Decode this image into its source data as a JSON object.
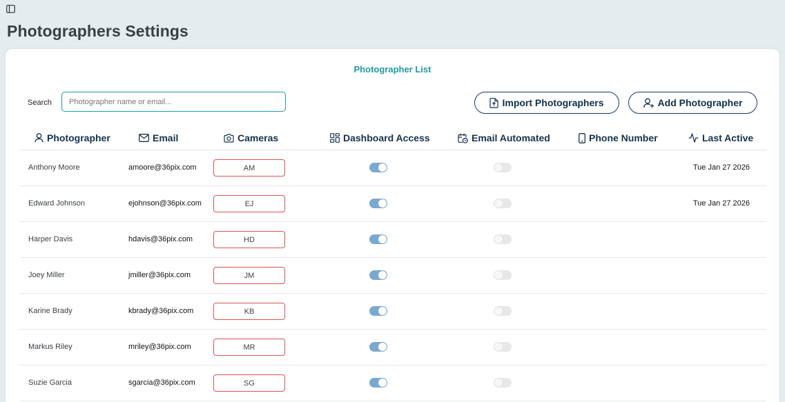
{
  "page": {
    "title": "Photographers Settings"
  },
  "card": {
    "title": "Photographer List"
  },
  "search": {
    "label": "Search",
    "placeholder": "Photographer name or email...",
    "value": ""
  },
  "buttons": {
    "import_label": "Import Photographers",
    "add_label": "Add Photographer"
  },
  "icons": {
    "sidebar_toggle": "sidebar-toggle-icon",
    "import": "file-upload-icon",
    "add": "user-plus-icon",
    "photographer": "user-icon",
    "email": "mail-icon",
    "cameras": "camera-icon",
    "dashboard": "dashboard-grid-icon",
    "email_automated": "calendar-clock-icon",
    "phone": "phone-icon",
    "last_active": "activity-icon"
  },
  "colors": {
    "accent": "#1f9aa0",
    "primary": "#0f3a5c",
    "camera_border": "#d9534f",
    "toggle_on": "#7aa9d0",
    "toggle_off": "#e8e8e8"
  },
  "columns": {
    "photographer": "Photographer",
    "email": "Email",
    "cameras": "Cameras",
    "dashboard": "Dashboard Access",
    "email_automated": "Email Automated",
    "phone": "Phone Number",
    "last_active": "Last Active"
  },
  "rows": [
    {
      "name": "Anthony Moore",
      "email": "amoore@36pix.com",
      "camera": "AM",
      "dashboard_access": true,
      "email_automated": false,
      "phone": "",
      "last_active": "Tue Jan 27 2026"
    },
    {
      "name": "Edward Johnson",
      "email": "ejohnson@36pix.com",
      "camera": "EJ",
      "dashboard_access": true,
      "email_automated": false,
      "phone": "",
      "last_active": "Tue Jan 27 2026"
    },
    {
      "name": "Harper Davis",
      "email": "hdavis@36pix.com",
      "camera": "HD",
      "dashboard_access": true,
      "email_automated": false,
      "phone": "",
      "last_active": ""
    },
    {
      "name": "Joey Miller",
      "email": "jmiller@36pix.com",
      "camera": "JM",
      "dashboard_access": true,
      "email_automated": false,
      "phone": "",
      "last_active": ""
    },
    {
      "name": "Karine Brady",
      "email": "kbrady@36pix.com",
      "camera": "KB",
      "dashboard_access": true,
      "email_automated": false,
      "phone": "",
      "last_active": ""
    },
    {
      "name": "Markus Riley",
      "email": "mriley@36pix.com",
      "camera": "MR",
      "dashboard_access": true,
      "email_automated": false,
      "phone": "",
      "last_active": ""
    },
    {
      "name": "Suzie Garcia",
      "email": "sgarcia@36pix.com",
      "camera": "SG",
      "dashboard_access": true,
      "email_automated": false,
      "phone": "",
      "last_active": ""
    }
  ]
}
